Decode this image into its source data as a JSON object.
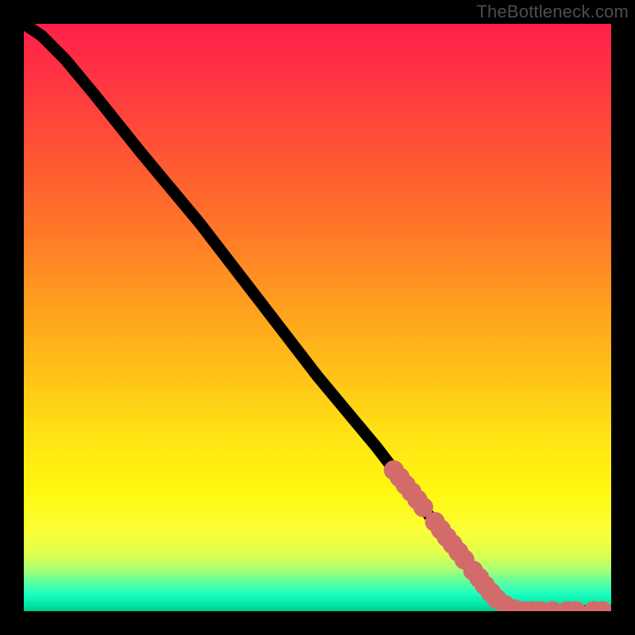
{
  "watermark": "TheBottleneck.com",
  "colors": {
    "frame_bg": "#000000",
    "curve": "#000000",
    "marker": "#d36b6b",
    "watermark_text": "#4d4d4d"
  },
  "chart_data": {
    "type": "line",
    "title": "",
    "xlabel": "",
    "ylabel": "",
    "xlim": [
      0,
      100
    ],
    "ylim": [
      0,
      100
    ],
    "gradient_stops": [
      {
        "pct": 0,
        "hex": "#ff1f4a"
      },
      {
        "pct": 12,
        "hex": "#ff3b3f"
      },
      {
        "pct": 24,
        "hex": "#ff5a32"
      },
      {
        "pct": 36,
        "hex": "#ff7a28"
      },
      {
        "pct": 48,
        "hex": "#ff9f1e"
      },
      {
        "pct": 60,
        "hex": "#ffc317"
      },
      {
        "pct": 70,
        "hex": "#ffe313"
      },
      {
        "pct": 80,
        "hex": "#fff811"
      },
      {
        "pct": 86,
        "hex": "#fdff34"
      },
      {
        "pct": 90,
        "hex": "#e2ff4b"
      },
      {
        "pct": 93,
        "hex": "#a8ff76"
      },
      {
        "pct": 95,
        "hex": "#5fffa0"
      },
      {
        "pct": 97,
        "hex": "#1effc0"
      },
      {
        "pct": 99,
        "hex": "#00e6a7"
      },
      {
        "pct": 100,
        "hex": "#00c98c"
      }
    ],
    "curve_points": [
      {
        "x": 0,
        "y": 100
      },
      {
        "x": 3,
        "y": 98
      },
      {
        "x": 7,
        "y": 94
      },
      {
        "x": 12,
        "y": 88
      },
      {
        "x": 20,
        "y": 78
      },
      {
        "x": 30,
        "y": 66
      },
      {
        "x": 40,
        "y": 53
      },
      {
        "x": 50,
        "y": 40
      },
      {
        "x": 60,
        "y": 28
      },
      {
        "x": 70,
        "y": 15
      },
      {
        "x": 78,
        "y": 5
      },
      {
        "x": 82,
        "y": 1
      },
      {
        "x": 85,
        "y": 0
      },
      {
        "x": 90,
        "y": 0
      },
      {
        "x": 95,
        "y": 0
      },
      {
        "x": 100,
        "y": 0
      }
    ],
    "markers": [
      {
        "x": 63,
        "y": 24
      },
      {
        "x": 64,
        "y": 22.8
      },
      {
        "x": 65,
        "y": 21.5
      },
      {
        "x": 66,
        "y": 20.3
      },
      {
        "x": 67,
        "y": 19.0
      },
      {
        "x": 68,
        "y": 17.7
      },
      {
        "x": 70,
        "y": 15.2
      },
      {
        "x": 71,
        "y": 13.9
      },
      {
        "x": 72,
        "y": 12.6
      },
      {
        "x": 73,
        "y": 11.4
      },
      {
        "x": 74,
        "y": 10.1
      },
      {
        "x": 75,
        "y": 8.8
      },
      {
        "x": 76.5,
        "y": 6.9
      },
      {
        "x": 77.5,
        "y": 5.7
      },
      {
        "x": 78.5,
        "y": 4.4
      },
      {
        "x": 79.5,
        "y": 3.2
      },
      {
        "x": 80.5,
        "y": 2.1
      },
      {
        "x": 82,
        "y": 1.0
      },
      {
        "x": 83.5,
        "y": 0.3
      },
      {
        "x": 85,
        "y": 0
      },
      {
        "x": 86.5,
        "y": 0
      },
      {
        "x": 88,
        "y": 0
      },
      {
        "x": 90,
        "y": 0
      },
      {
        "x": 92.5,
        "y": 0
      },
      {
        "x": 94,
        "y": 0
      },
      {
        "x": 97,
        "y": 0
      },
      {
        "x": 98.5,
        "y": 0
      }
    ],
    "marker_radius": 1.2
  }
}
